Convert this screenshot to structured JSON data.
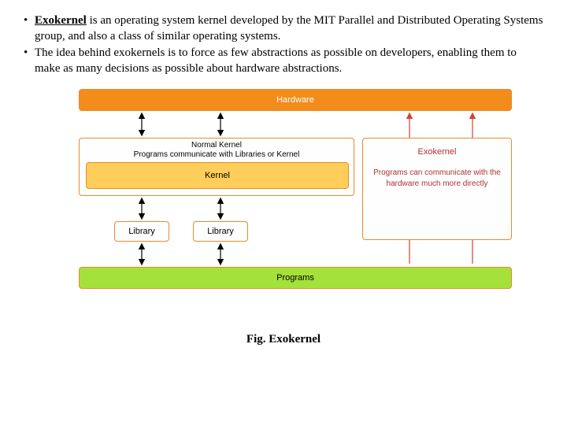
{
  "bullets": [
    {
      "bold": "Exokernel",
      "rest": " is an operating system kernel developed by the MIT Parallel and Distributed Operating Systems group, and also a class of similar operating systems."
    },
    {
      "bold": "",
      "rest": "The idea behind exokernels is to force as few abstractions as possible on developers, enabling them to make as many decisions as possible about hardware abstractions."
    }
  ],
  "diagram": {
    "hardware": "Hardware",
    "normal_title_line1": "Normal Kernel",
    "normal_title_line2": "Programs communicate with Libraries or Kernel",
    "kernel": "Kernel",
    "exokernel_title": "Exokernel",
    "exokernel_desc": "Programs can communicate with the hardware much more directly",
    "library": "Library",
    "programs": "Programs"
  },
  "caption": "Fig. Exokernel",
  "colors": {
    "hardware_bg": "#f28c1b",
    "kernel_bg": "#ffcd59",
    "programs_bg": "#a4e13a",
    "border": "#e88b2e",
    "exo_text": "#b03030"
  }
}
